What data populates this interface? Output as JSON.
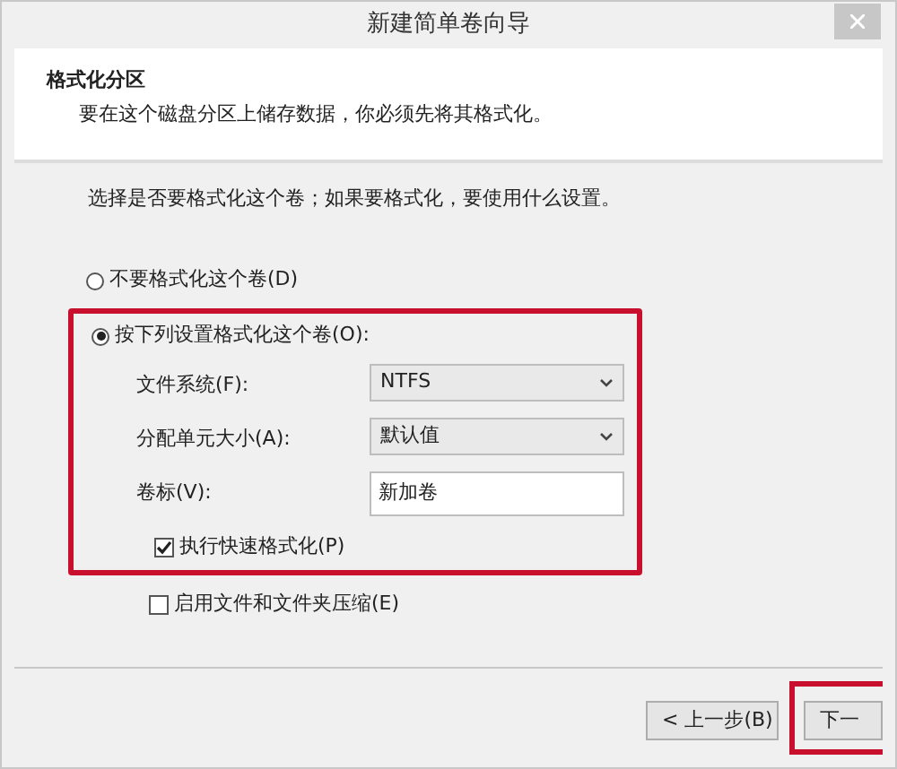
{
  "window": {
    "title": "新建简单卷向导"
  },
  "header": {
    "title": "格式化分区",
    "subtitle": "要在这个磁盘分区上储存数据，你必须先将其格式化。"
  },
  "instruction": "选择是否要格式化这个卷；如果要格式化，要使用什么设置。",
  "options": [
    {
      "label": "不要格式化这个卷(D)",
      "selected": false
    },
    {
      "label": "按下列设置格式化这个卷(O):",
      "selected": true
    }
  ],
  "fields": [
    {
      "kind": "select",
      "label": "文件系统(F):",
      "value": "NTFS"
    },
    {
      "kind": "select",
      "label": "分配单元大小(A):",
      "value": "默认值"
    },
    {
      "kind": "text",
      "label": "卷标(V):",
      "value": "新加卷"
    }
  ],
  "checkboxes": [
    {
      "label": "执行快速格式化(P)",
      "checked": true,
      "highlighted": true
    },
    {
      "label": "启用文件和文件夹压缩(E)",
      "checked": false,
      "highlighted": false
    }
  ],
  "buttons": [
    {
      "label": "< 上一步(B)",
      "highlighted": false
    },
    {
      "label": "下一",
      "highlighted": true
    }
  ]
}
